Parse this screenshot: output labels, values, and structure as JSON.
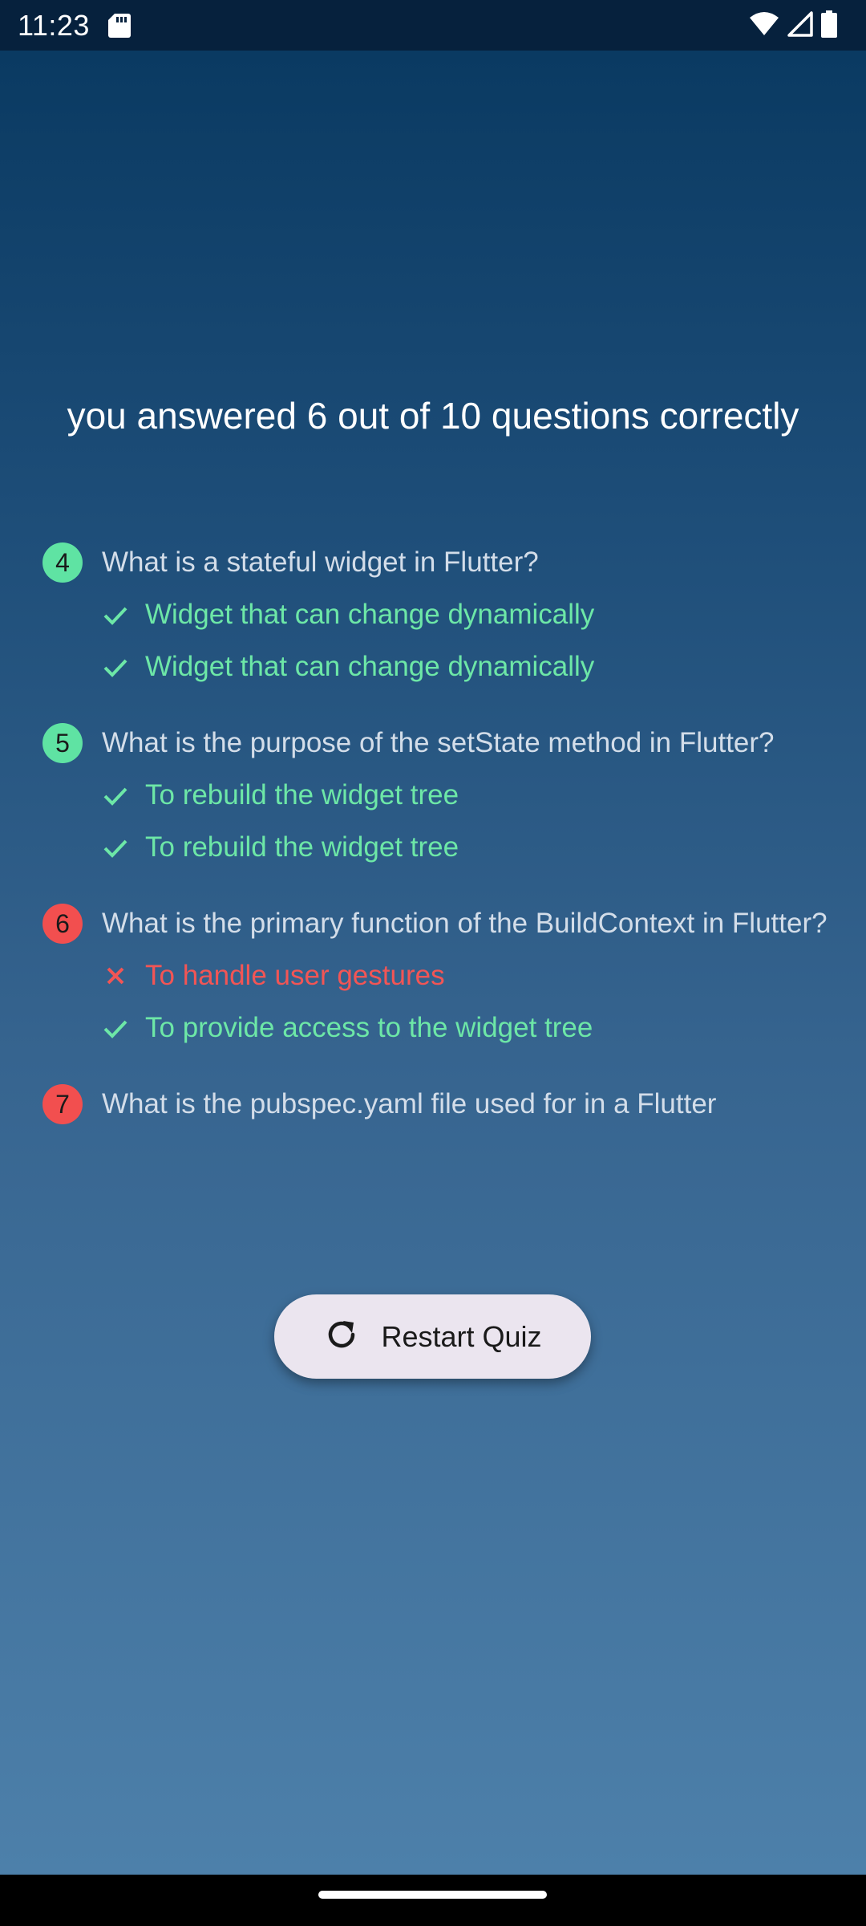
{
  "status_bar": {
    "time": "11:23",
    "icons": [
      "sd-card-icon",
      "wifi-icon",
      "signal-icon",
      "battery-icon"
    ]
  },
  "result": {
    "score_text": "you answered 6 out of 10 questions correctly"
  },
  "summary": [
    {
      "number": "4",
      "status": "correct",
      "question": "What is a stateful widget in Flutter?",
      "answers": [
        {
          "type": "correct",
          "icon": "check-icon",
          "text": "Widget that can change dynamically"
        },
        {
          "type": "correct",
          "icon": "check-icon",
          "text": "Widget that can change dynamically"
        }
      ]
    },
    {
      "number": "5",
      "status": "correct",
      "question": "What is the purpose of the setState method in Flutter?",
      "answers": [
        {
          "type": "correct",
          "icon": "check-icon",
          "text": "To rebuild the widget tree"
        },
        {
          "type": "correct",
          "icon": "check-icon",
          "text": "To rebuild the widget tree"
        }
      ]
    },
    {
      "number": "6",
      "status": "wrong",
      "question": "What is the primary function of the BuildContext in Flutter?",
      "answers": [
        {
          "type": "wrong",
          "icon": "close-icon",
          "text": "To handle user gestures"
        },
        {
          "type": "correct",
          "icon": "check-icon",
          "text": "To provide access to the widget tree"
        }
      ]
    },
    {
      "number": "7",
      "status": "wrong",
      "question": "What is the pubspec.yaml file used for in a Flutter",
      "answers": []
    }
  ],
  "restart": {
    "label": "Restart Quiz",
    "icon": "refresh-icon"
  },
  "colors": {
    "correct": "#6de7a7",
    "correct_badge": "#5fe3a3",
    "wrong": "#f25555",
    "wrong_badge": "#f24f4f",
    "button_bg": "#ebe5ef",
    "gradient_top": "#0a3a62",
    "gradient_bottom": "#4d80aa"
  }
}
